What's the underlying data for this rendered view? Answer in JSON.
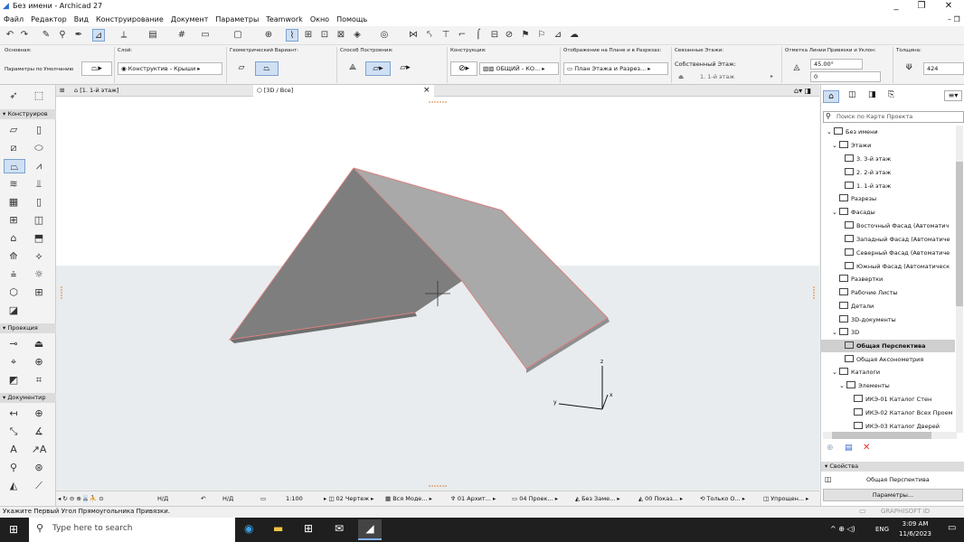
{
  "window": {
    "title": "Без имени - Archicad 27",
    "controls": [
      "_",
      "❐",
      "✕"
    ]
  },
  "menu": [
    "Файл",
    "Редактор",
    "Вид",
    "Конструирование",
    "Документ",
    "Параметры",
    "Teamwork",
    "Окно",
    "Помощь"
  ],
  "infobox": {
    "main_label": "Основная:",
    "main_value": "Параметры по Умолчанию",
    "layer_label": "Слой:",
    "layer_value": "Конструктив - Крыши",
    "geom_label": "Геометрический Вариант:",
    "method_label": "Способ Построения:",
    "construct_label": "Конструкция:",
    "construct_value": "ОБЩИЙ - КО...",
    "display_label": "Отображение на Плане и в Разрезах:",
    "display_value": "План Этажа и Разрез...",
    "linked_label": "Связанные Этажи:",
    "home_story_label": "Собственный Этаж:",
    "home_story_value": "1. 1-й этаж",
    "pivot_label": "Отметка Линии Привязки и Уклон:",
    "angle_value": "45.00°",
    "pivot_value": "0",
    "thick_label": "Толщина:",
    "thick_value": "424"
  },
  "left_sections": {
    "design": "Конструиров",
    "projection": "Проекция",
    "document": "Документир"
  },
  "tabs": {
    "plan": "[1. 1-й этаж]",
    "view3d": "[3D / Все]",
    "close": "×"
  },
  "status": {
    "nd1": "Н/Д",
    "nd2": "Н/Д",
    "scale": "1:100",
    "s1": "02 Чертеж",
    "s2": "Вся Моде...",
    "s3": "01 Архит...",
    "s4": "04 Проек...",
    "s5": "Без Заме...",
    "s6": "00 Показ...",
    "s7": "Только О...",
    "s8": "Упрощен..."
  },
  "axes": {
    "x": "x",
    "y": "y",
    "z": "z"
  },
  "hint": "Укажите Первый Угол Прямоугольника Привязки.",
  "nav": {
    "search_placeholder": "Поиск по Карте Проекта",
    "items": [
      {
        "label": "Без имени"
      },
      {
        "label": "Этажи"
      },
      {
        "label": "3. 3-й этаж"
      },
      {
        "label": "2. 2-й этаж"
      },
      {
        "label": "1. 1-й этаж"
      },
      {
        "label": "Разрезы"
      },
      {
        "label": "Фасады"
      },
      {
        "label": "Восточный Фасад (Автоматич"
      },
      {
        "label": "Западный Фасад (Автоматиче"
      },
      {
        "label": "Северный Фасад (Автоматиче"
      },
      {
        "label": "Южный Фасад (Автоматическ"
      },
      {
        "label": "Развертки"
      },
      {
        "label": "Рабочие Листы"
      },
      {
        "label": "Детали"
      },
      {
        "label": "3D-документы"
      },
      {
        "label": "3D"
      },
      {
        "label": "Общая Перспектива"
      },
      {
        "label": "Общая Аксонометрия"
      },
      {
        "label": "Каталоги"
      },
      {
        "label": "Элементы"
      },
      {
        "label": "ИКЭ-01 Каталог Стен"
      },
      {
        "label": "ИКЭ-02 Каталог Всех Проем"
      },
      {
        "label": "ИКЭ-03 Каталог Дверей"
      }
    ],
    "props_header": "Свойства",
    "props_value": "Общая Перспектива",
    "params_button": "Параметры...",
    "brand": "GRAPHISOFT ID"
  },
  "taskbar": {
    "search": "Type here to search",
    "lang": "ENG",
    "time": "3:09 AM",
    "date": "11/6/2023"
  }
}
